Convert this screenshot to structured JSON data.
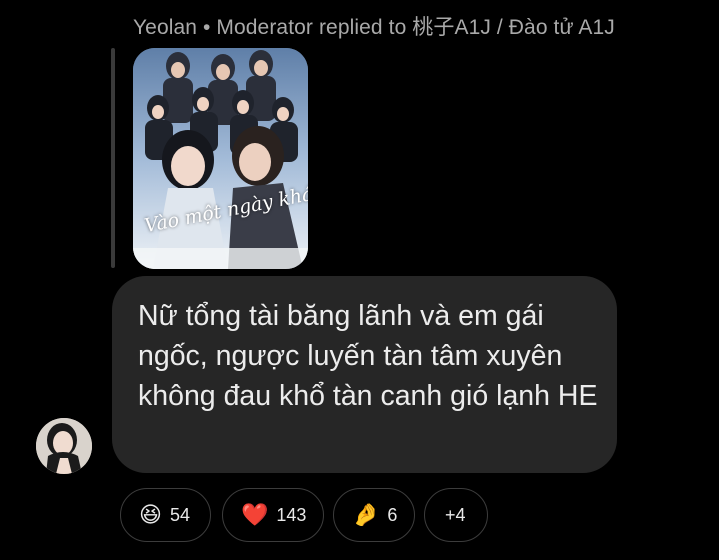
{
  "reply": {
    "author": "Yeolan",
    "separator": "•",
    "role": "Moderator",
    "action": "replied to",
    "target": "桃子A1J / Đào tử A1J"
  },
  "quoted_image": {
    "title_text": "Vào một ngày khác"
  },
  "message": {
    "text": "Nữ tổng tài băng lãnh và em gái ngốc, ngược luyến tàn tâm xuyên không đau khổ tàn canh gió lạnh HE"
  },
  "reactions": [
    {
      "emoji": "😆",
      "icon": "laughing-face-icon",
      "count": "54"
    },
    {
      "emoji": "❤️",
      "icon": "red-heart-icon",
      "count": "143"
    },
    {
      "emoji": "🤌",
      "icon": "pinched-fingers-icon",
      "count": "6"
    },
    {
      "emoji": "",
      "icon": "",
      "count": "+4"
    }
  ],
  "colors": {
    "background": "#000000",
    "bubble": "#262626",
    "header_text": "#a9a9a9",
    "reaction_border": "#3c3c3c"
  }
}
